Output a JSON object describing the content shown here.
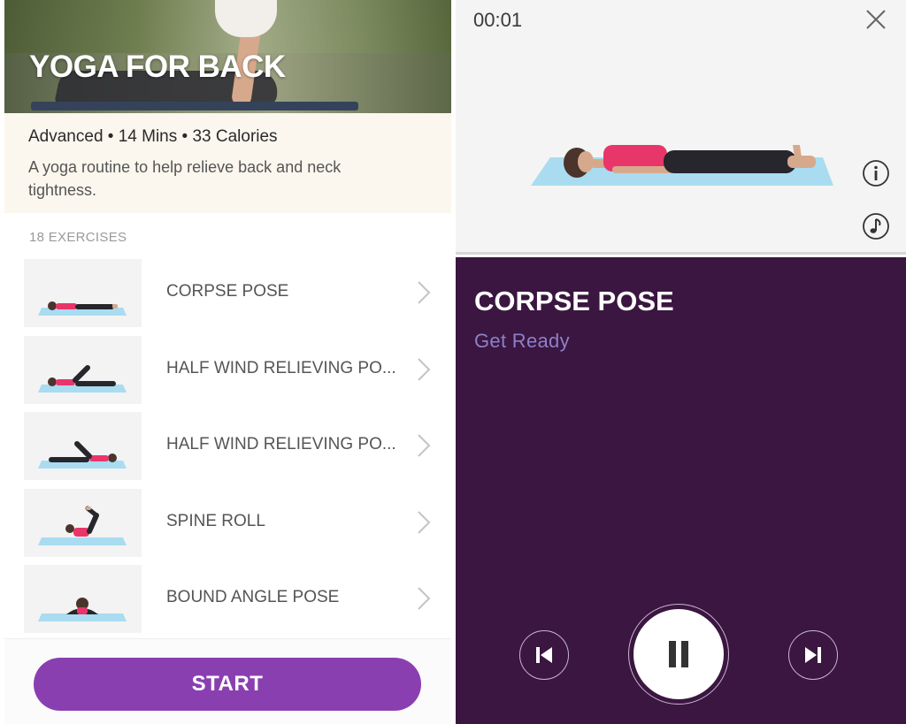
{
  "routine": {
    "title": "YOGA FOR BACK",
    "meta": "Advanced • 14 Mins • 33 Calories",
    "description": "A yoga routine to help relieve back and neck tightness.",
    "exercise_count": "18 EXERCISES",
    "start_label": "START"
  },
  "exercises": [
    {
      "name": "CORPSE POSE",
      "icon": "corpse-pose-thumbnail"
    },
    {
      "name": "HALF WIND RELIEVING PO...",
      "icon": "half-wind-relieving-pose-thumbnail"
    },
    {
      "name": "HALF WIND RELIEVING PO...",
      "icon": "half-wind-relieving-pose-thumbnail"
    },
    {
      "name": "SPINE ROLL",
      "icon": "spine-roll-thumbnail"
    },
    {
      "name": "BOUND ANGLE POSE",
      "icon": "bound-angle-pose-thumbnail"
    }
  ],
  "player": {
    "timer": "00:01",
    "pose_title": "CORPSE POSE",
    "status": "Get Ready",
    "icons": [
      "close-icon",
      "info-icon",
      "music-icon",
      "previous-icon",
      "pause-icon",
      "next-icon"
    ]
  },
  "colors": {
    "accent_purple": "#8a3fb1",
    "player_background": "#3a1640",
    "status_text": "#8e80c8",
    "info_background": "#fbf7ee",
    "mat_blue": "#a9dcf0",
    "shirt_pink": "#e8366a"
  }
}
